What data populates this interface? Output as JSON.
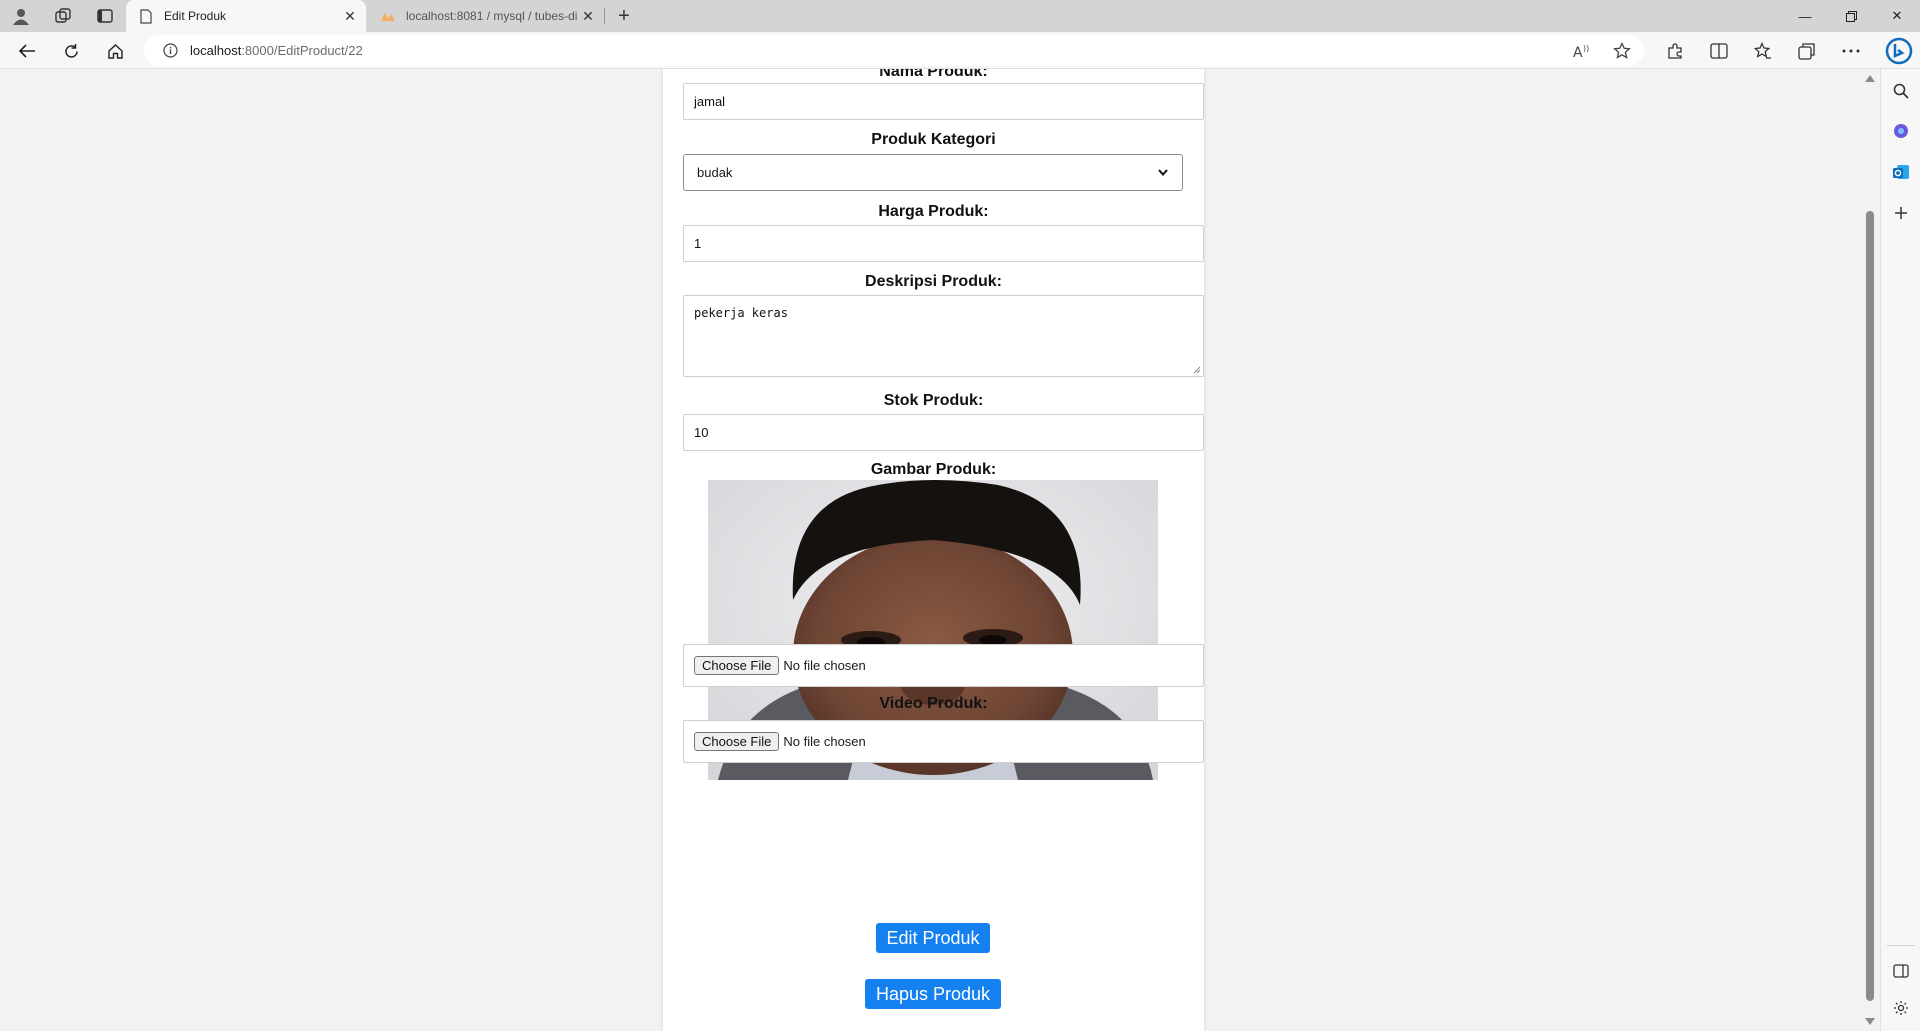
{
  "browser": {
    "tabs": [
      {
        "title": "Edit Produk",
        "active": true
      },
      {
        "title": "localhost:8081 / mysql / tubes-di",
        "active": false
      }
    ],
    "address": {
      "host": "localhost",
      "path": ":8000/EditProduct/22"
    },
    "icons": {
      "profile": "profile-icon",
      "workspaces": "workspaces-icon",
      "tab_actions": "tab-actions-icon",
      "back": "back-icon",
      "refresh": "refresh-icon",
      "home": "home-icon",
      "info": "info-icon",
      "read_aloud": "read-aloud-icon",
      "favorite": "star-icon",
      "extensions": "extensions-icon",
      "split": "split-screen-icon",
      "favorites": "favorites-icon",
      "collections": "collections-icon",
      "more": "more-icon",
      "copilot": "copilot-icon"
    }
  },
  "form": {
    "nama_label": "Nama Produk:",
    "nama_value": "jamal",
    "kategori_label": "Produk Kategori",
    "kategori_value": "budak",
    "harga_label": "Harga Produk:",
    "harga_value": "1",
    "deskripsi_label": "Deskripsi Produk:",
    "deskripsi_value": "pekerja keras",
    "stok_label": "Stok Produk:",
    "stok_value": "10",
    "gambar_label": "Gambar Produk:",
    "gambar_button": "Choose File",
    "gambar_status": "No file chosen",
    "video_label": "Video Produk:",
    "video_button": "Choose File",
    "video_status": "No file chosen",
    "edit_button": "Edit Produk",
    "hapus_button": "Hapus Produk"
  },
  "colors": {
    "accent": "#1581f0",
    "edge_blue": "#0f6cbd"
  }
}
